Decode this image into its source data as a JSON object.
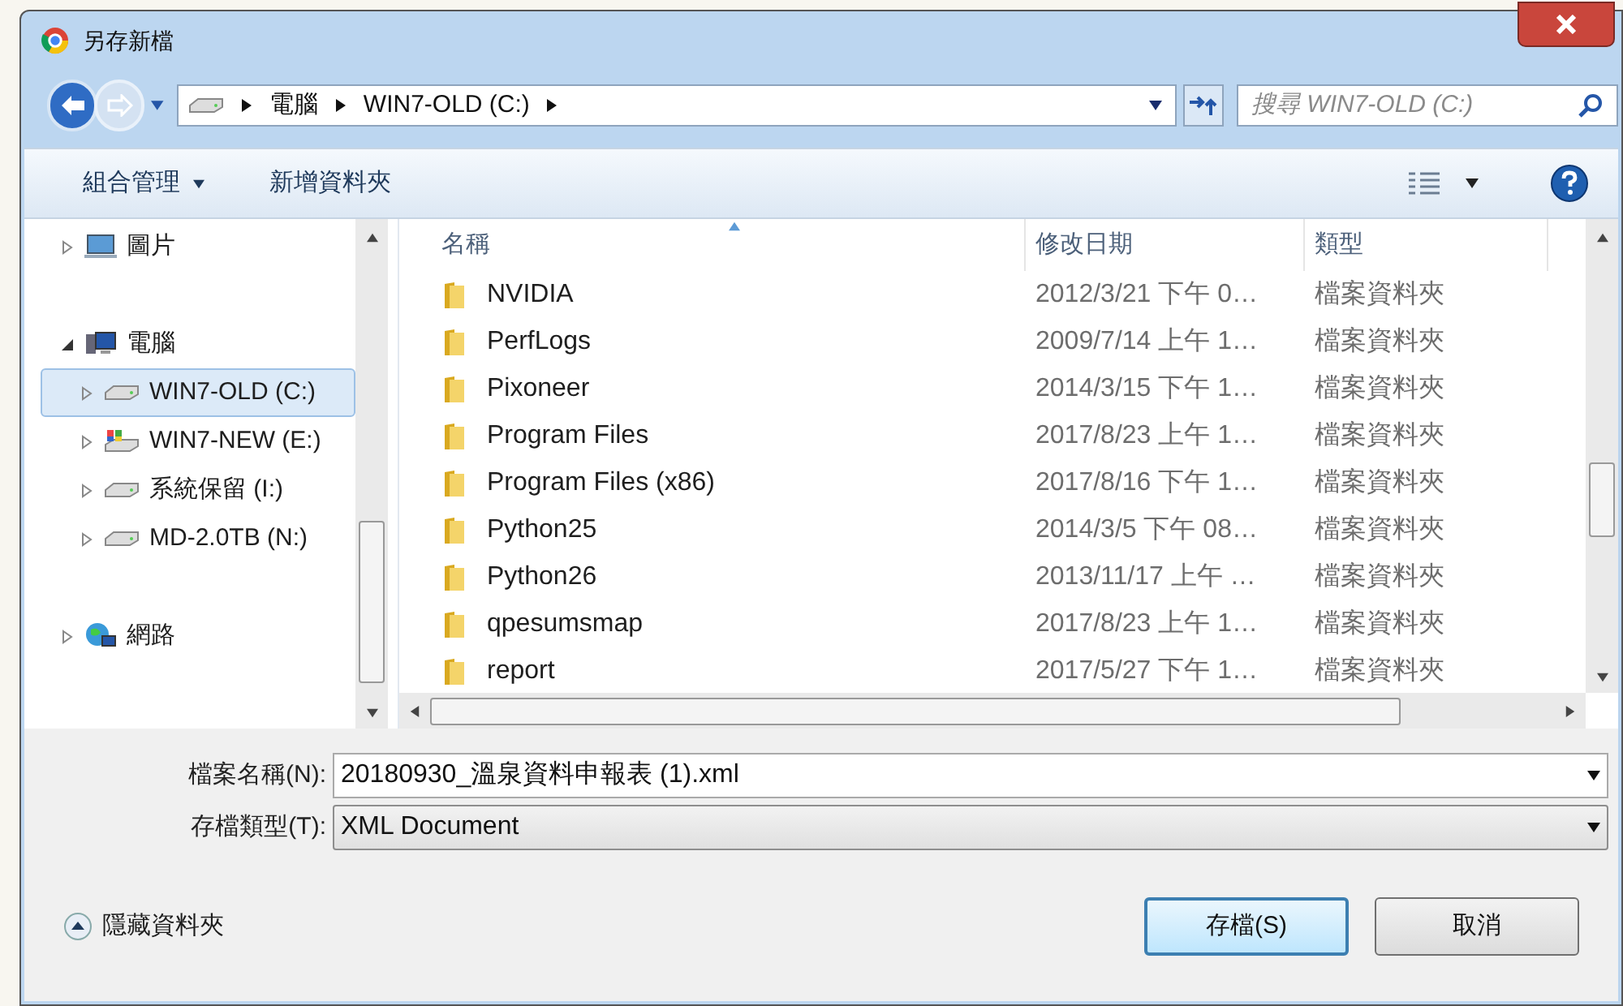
{
  "window": {
    "title": "另存新檔"
  },
  "address": {
    "path": [
      "電腦",
      "WIN7-OLD (C:)"
    ]
  },
  "search": {
    "placeholder": "搜尋 WIN7-OLD (C:)"
  },
  "toolbar": {
    "organize": "組合管理",
    "new_folder": "新增資料夾"
  },
  "sidebar": {
    "items": [
      {
        "label": "圖片",
        "kind": "pictures",
        "expanded": false,
        "selected": false
      },
      {
        "label": "電腦",
        "kind": "computer",
        "expanded": true,
        "selected": false,
        "children": [
          {
            "label": "WIN7-OLD (C:)",
            "kind": "drive",
            "expanded": false,
            "selected": true
          },
          {
            "label": "WIN7-NEW (E:)",
            "kind": "windows-drive",
            "expanded": false,
            "selected": false
          },
          {
            "label": "系統保留 (I:)",
            "kind": "drive",
            "expanded": false,
            "selected": false
          },
          {
            "label": "MD-2.0TB (N:)",
            "kind": "drive",
            "expanded": false,
            "selected": false
          }
        ]
      },
      {
        "label": "網路",
        "kind": "network",
        "expanded": false,
        "selected": false
      }
    ]
  },
  "file_list": {
    "columns": [
      {
        "label": "名稱",
        "sorted": true
      },
      {
        "label": "修改日期",
        "sorted": false
      },
      {
        "label": "類型",
        "sorted": false
      }
    ],
    "rows": [
      {
        "name": "NVIDIA",
        "modified": "2012/3/21 下午 0…",
        "type": "檔案資料夾"
      },
      {
        "name": "PerfLogs",
        "modified": "2009/7/14 上午 1…",
        "type": "檔案資料夾"
      },
      {
        "name": "Pixoneer",
        "modified": "2014/3/15 下午 1…",
        "type": "檔案資料夾"
      },
      {
        "name": "Program Files",
        "modified": "2017/8/23 上午 1…",
        "type": "檔案資料夾"
      },
      {
        "name": "Program Files (x86)",
        "modified": "2017/8/16 下午 1…",
        "type": "檔案資料夾"
      },
      {
        "name": "Python25",
        "modified": "2014/3/5 下午 08…",
        "type": "檔案資料夾"
      },
      {
        "name": "Python26",
        "modified": "2013/11/17 上午 …",
        "type": "檔案資料夾"
      },
      {
        "name": "qpesumsmap",
        "modified": "2017/8/23 上午 1…",
        "type": "檔案資料夾"
      },
      {
        "name": "report",
        "modified": "2017/5/27 下午 1…",
        "type": "檔案資料夾"
      }
    ]
  },
  "form": {
    "filename_label": "檔案名稱(N):",
    "filename": "20180930_溫泉資料申報表 (1).xml",
    "type_label": "存檔類型(T):",
    "type": "XML Document"
  },
  "hide_folders": "隱藏資料夾",
  "buttons": [
    {
      "label": "存檔(S)",
      "default": true
    },
    {
      "label": "取消",
      "default": false
    }
  ]
}
